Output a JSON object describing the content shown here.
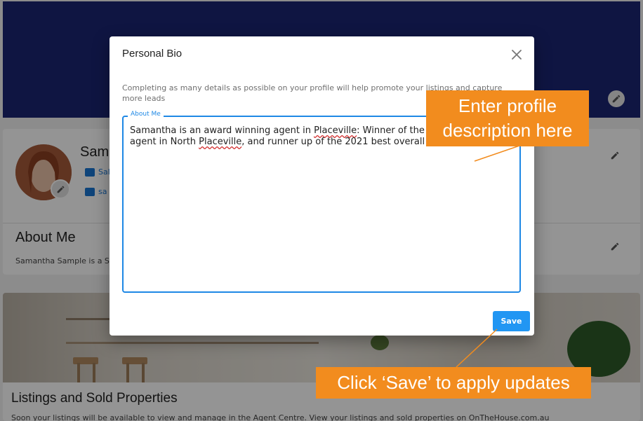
{
  "background_page": {
    "profile_name": "Sam",
    "profile_meta_1": "Sal",
    "profile_meta_2": "sa",
    "about_title": "About Me",
    "about_text": "Samantha Sample is a S",
    "listings_title": "Listings and Sold Properties",
    "listings_text": "Soon your listings will be available to view and manage in the Agent Centre. View your listings and sold properties on OnTheHouse.com.au"
  },
  "dialog": {
    "title": "Personal Bio",
    "close_icon": "close-icon",
    "helper_text": "Completing as many details as possible on your profile will help promote your listings and capture more leads",
    "field_label": "About Me",
    "bio_part_1": "Samantha is an award winning agent in ",
    "bio_word_1": "Placeville",
    "bio_part_2": ": Winner of the 20",
    "bio_part_3": "agent in North ",
    "bio_word_2": "Placeville",
    "bio_part_4": ", and runner up of the 2021 best overall age",
    "save_label": "Save"
  },
  "callouts": {
    "enter_profile": "Enter profile description here",
    "click_save": "Click ‘Save’ to apply updates"
  },
  "colors": {
    "banner": "#1a2573",
    "accent": "#2196f3",
    "callout": "#f28c1e"
  }
}
